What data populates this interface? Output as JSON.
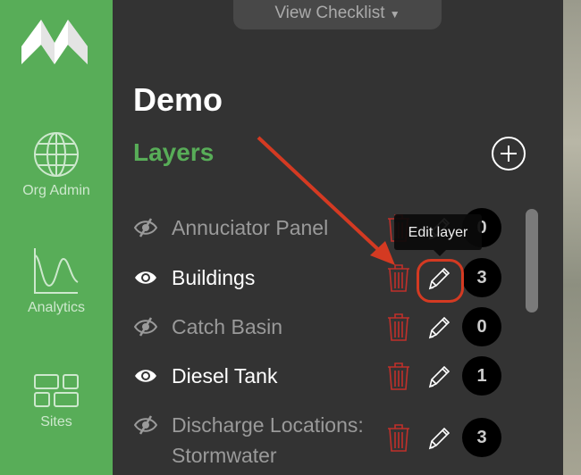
{
  "sidebar": {
    "items": [
      {
        "label": "Org Admin",
        "icon": "globe-icon"
      },
      {
        "label": "Analytics",
        "icon": "analytics-chart-icon"
      },
      {
        "label": "Sites",
        "icon": "sites-grid-icon"
      }
    ]
  },
  "header": {
    "checklist_label": "View Checklist"
  },
  "main": {
    "title": "Demo",
    "section": "Layers",
    "tooltip": "Edit layer",
    "layers": [
      {
        "name": "Annuciator Panel",
        "visible": false,
        "count": "0"
      },
      {
        "name": "Buildings",
        "visible": true,
        "count": "3"
      },
      {
        "name": "Catch Basin",
        "visible": false,
        "count": "0"
      },
      {
        "name": "Diesel Tank",
        "visible": true,
        "count": "1"
      },
      {
        "name": "Discharge Locations: Stormwater",
        "visible": false,
        "count": "3"
      }
    ]
  },
  "colors": {
    "sidebar": "#58ad58",
    "accent_green": "#58ad58",
    "panel": "#333333",
    "delete_red": "#c0302a",
    "annotation_red": "#d43a22"
  }
}
